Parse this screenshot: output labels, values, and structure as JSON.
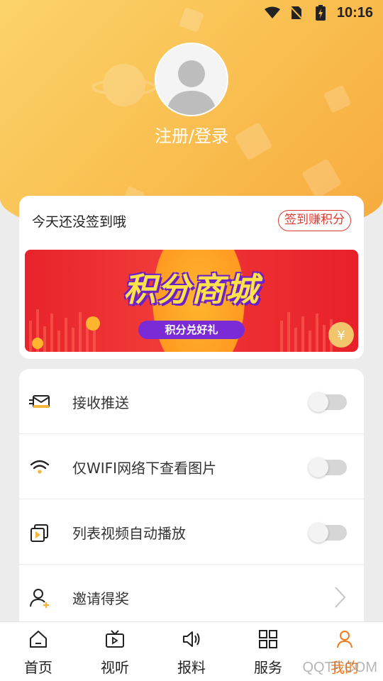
{
  "status_bar": {
    "time": "10:16"
  },
  "profile": {
    "login_label": "注册/登录"
  },
  "checkin": {
    "message": "今天还没签到哦",
    "earn_button": "签到赚积分",
    "banner": {
      "title": "积分商城",
      "subtitle": "积分兑好礼"
    }
  },
  "settings": {
    "items": [
      {
        "label": "接收推送",
        "icon": "envelope-icon",
        "control": "toggle",
        "enabled": false
      },
      {
        "label": "仅WIFI网络下查看图片",
        "icon": "wifi-icon",
        "control": "toggle",
        "enabled": false
      },
      {
        "label": "列表视频自动播放",
        "icon": "video-icon",
        "control": "toggle",
        "enabled": false
      },
      {
        "label": "邀请得奖",
        "icon": "invite-user-icon",
        "control": "chevron"
      }
    ]
  },
  "tabbar": {
    "tabs": [
      {
        "label": "首页",
        "icon": "home-icon"
      },
      {
        "label": "视听",
        "icon": "tv-icon"
      },
      {
        "label": "报料",
        "icon": "speaker-icon"
      },
      {
        "label": "服务",
        "icon": "grid-icon"
      },
      {
        "label": "我的",
        "icon": "user-icon",
        "active": true
      }
    ]
  },
  "colors": {
    "accent": "#f07a1e",
    "header": "#f9bd4f",
    "alert": "#e03a2f"
  },
  "watermark": "QQTF.COM"
}
